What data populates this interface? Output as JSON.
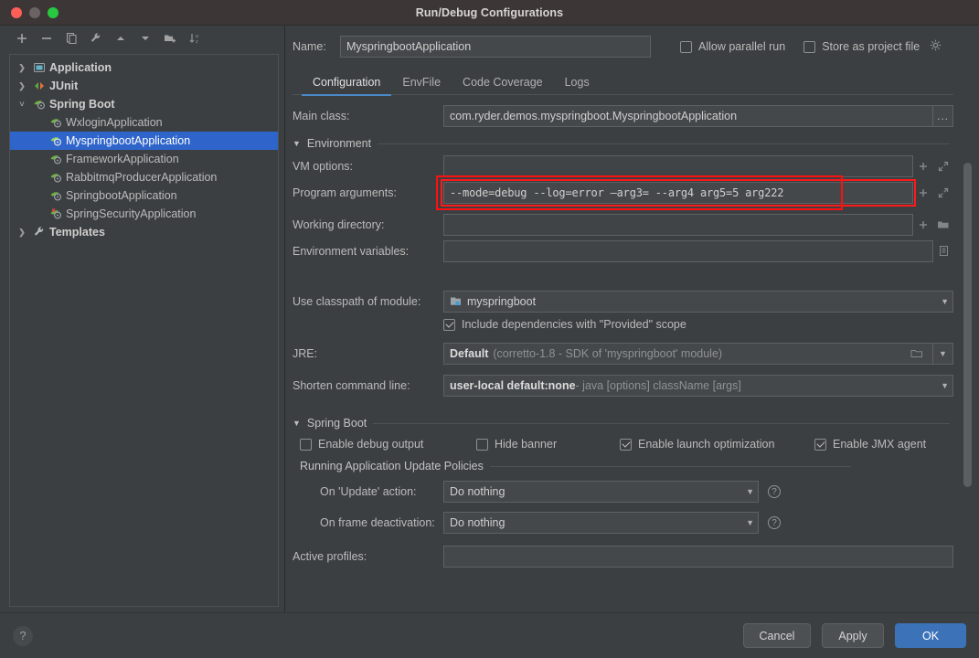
{
  "window": {
    "title": "Run/Debug Configurations",
    "traffic_lights": [
      "close-red",
      "minimize-gray",
      "maximize-green"
    ]
  },
  "sidebar": {
    "toolbar": [
      {
        "name": "add-configuration",
        "icon": "plus-icon"
      },
      {
        "name": "remove-configuration",
        "icon": "minus-icon"
      },
      {
        "name": "copy-configuration",
        "icon": "copy-icon"
      },
      {
        "name": "edit-templates",
        "icon": "wrench-icon"
      },
      {
        "name": "move-up",
        "icon": "arrow-up-icon"
      },
      {
        "name": "move-down",
        "icon": "arrow-down-icon"
      },
      {
        "name": "move-into-folder",
        "icon": "folder-add-icon"
      },
      {
        "name": "sort-configurations",
        "icon": "sort-alpha-icon"
      }
    ],
    "tree": [
      {
        "label": "Application",
        "level": 0,
        "twisty": "collapsed",
        "icon": "application-icon",
        "selected": false,
        "bold": true
      },
      {
        "label": "JUnit",
        "level": 0,
        "twisty": "collapsed",
        "icon": "junit-icon",
        "selected": false,
        "bold": true
      },
      {
        "label": "Spring Boot",
        "level": 0,
        "twisty": "expanded",
        "icon": "spring-boot-icon",
        "selected": false,
        "bold": true
      },
      {
        "label": "WxloginApplication",
        "level": 1,
        "twisty": "none",
        "icon": "spring-boot-icon",
        "selected": false,
        "bold": false
      },
      {
        "label": "MyspringbootApplication",
        "level": 1,
        "twisty": "none",
        "icon": "spring-boot-icon",
        "selected": true,
        "bold": false
      },
      {
        "label": "FrameworkApplication",
        "level": 1,
        "twisty": "none",
        "icon": "spring-boot-icon",
        "selected": false,
        "bold": false
      },
      {
        "label": "RabbitmqProducerApplication",
        "level": 1,
        "twisty": "none",
        "icon": "spring-boot-icon",
        "selected": false,
        "bold": false
      },
      {
        "label": "SpringbootApplication",
        "level": 1,
        "twisty": "none",
        "icon": "spring-boot-icon",
        "selected": false,
        "bold": false
      },
      {
        "label": "SpringSecurityApplication",
        "level": 1,
        "twisty": "none",
        "icon": "spring-boot-error-icon",
        "selected": false,
        "bold": false
      },
      {
        "label": "Templates",
        "level": 0,
        "twisty": "collapsed",
        "icon": "wrench-icon",
        "selected": false,
        "bold": true
      }
    ]
  },
  "header": {
    "name_label": "Name:",
    "name_value": "MyspringbootApplication",
    "allow_parallel_run": {
      "label": "Allow parallel run",
      "checked": false
    },
    "store_as_project_file": {
      "label": "Store as project file",
      "checked": false
    }
  },
  "tabs": [
    {
      "label": "Configuration",
      "active": true
    },
    {
      "label": "EnvFile",
      "active": false
    },
    {
      "label": "Code Coverage",
      "active": false
    },
    {
      "label": "Logs",
      "active": false
    }
  ],
  "form": {
    "main_class": {
      "label": "Main class:",
      "value": "com.ryder.demos.myspringboot.MyspringbootApplication",
      "browse": "..."
    },
    "environment_section": "Environment",
    "vm_options": {
      "label": "VM options:",
      "value": ""
    },
    "program_arguments": {
      "label": "Program arguments:",
      "value": "--mode=debug --log=error —arg3= --arg4 arg5=5 arg222",
      "highlighted": true
    },
    "working_directory": {
      "label": "Working directory:",
      "value": ""
    },
    "environment_variables": {
      "label": "Environment variables:",
      "value": ""
    },
    "use_classpath": {
      "label": "Use classpath of module:",
      "value": "myspringboot"
    },
    "include_provided": {
      "label": "Include dependencies with \"Provided\" scope",
      "checked": true
    },
    "jre": {
      "label": "JRE:",
      "value_bold": "Default",
      "value_muted": "(corretto-1.8 - SDK of 'myspringboot' module)"
    },
    "shorten_command_line": {
      "label": "Shorten command line:",
      "value_bold_pre": "user-local default: ",
      "value_bold": "none",
      "value_muted": " - java [options] className [args]"
    }
  },
  "spring_boot": {
    "section_title": "Spring Boot",
    "checkboxes": [
      {
        "label": "Enable debug output",
        "checked": false
      },
      {
        "label": "Hide banner",
        "checked": false
      },
      {
        "label": "Enable launch optimization",
        "checked": true
      },
      {
        "label": "Enable JMX agent",
        "checked": true
      }
    ],
    "policies_title": "Running Application Update Policies",
    "on_update_action": {
      "label": "On 'Update' action:",
      "value": "Do nothing"
    },
    "on_frame_deactivation": {
      "label": "On frame deactivation:",
      "value": "Do nothing"
    },
    "active_profiles": {
      "label": "Active profiles:",
      "value": ""
    }
  },
  "footer": {
    "help": "?",
    "cancel": "Cancel",
    "apply": "Apply",
    "ok": "OK"
  },
  "colors": {
    "accent_blue": "#3b72b8",
    "selection_blue": "#2f65ca",
    "tab_underline": "#4a88c7",
    "highlight_red": "#ff1010",
    "background": "#3c3f41",
    "titlebar": "#3d3637"
  }
}
